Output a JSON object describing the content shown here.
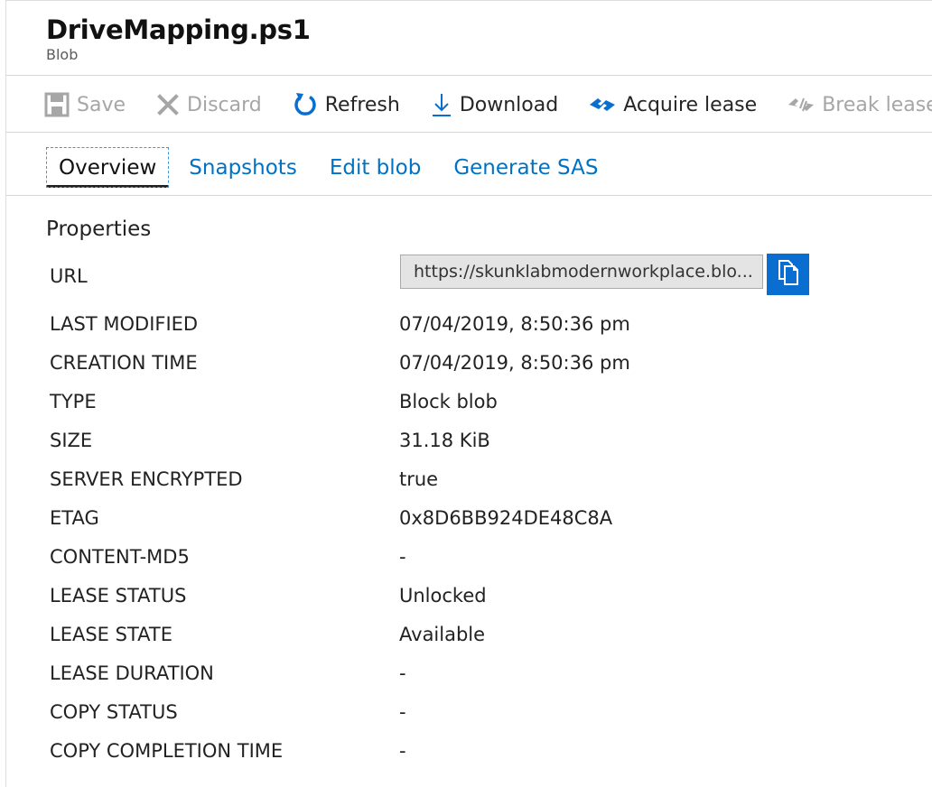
{
  "header": {
    "title": "DriveMapping.ps1",
    "subtitle": "Blob"
  },
  "toolbar": {
    "save": "Save",
    "discard": "Discard",
    "refresh": "Refresh",
    "download": "Download",
    "acquire_lease": "Acquire lease",
    "break_lease": "Break lease"
  },
  "tabs": [
    "Overview",
    "Snapshots",
    "Edit blob",
    "Generate SAS"
  ],
  "properties": {
    "title": "Properties",
    "url_label": "URL",
    "url_value": "https://skunklabmodernworkplace.blo...",
    "rows": [
      {
        "label": "LAST MODIFIED",
        "value": "07/04/2019, 8:50:36 pm"
      },
      {
        "label": "CREATION TIME",
        "value": "07/04/2019, 8:50:36 pm"
      },
      {
        "label": "TYPE",
        "value": "Block blob"
      },
      {
        "label": "SIZE",
        "value": "31.18 KiB"
      },
      {
        "label": "SERVER ENCRYPTED",
        "value": "true"
      },
      {
        "label": "ETAG",
        "value": "0x8D6BB924DE48C8A"
      },
      {
        "label": "CONTENT-MD5",
        "value": "-"
      },
      {
        "label": "LEASE STATUS",
        "value": "Unlocked"
      },
      {
        "label": "LEASE STATE",
        "value": "Available"
      },
      {
        "label": "LEASE DURATION",
        "value": "-"
      },
      {
        "label": "COPY STATUS",
        "value": "-"
      },
      {
        "label": "COPY COMPLETION TIME",
        "value": "-"
      }
    ]
  },
  "icons": {
    "save": "save-icon",
    "discard": "close-icon",
    "refresh": "refresh-icon",
    "download": "download-icon",
    "acquire_lease": "lease-icon",
    "break_lease": "break-lease-icon",
    "copy": "copy-icon"
  },
  "colors": {
    "accent": "#0a6ed1",
    "link": "#0072c6",
    "disabled": "#a6a6a6"
  }
}
